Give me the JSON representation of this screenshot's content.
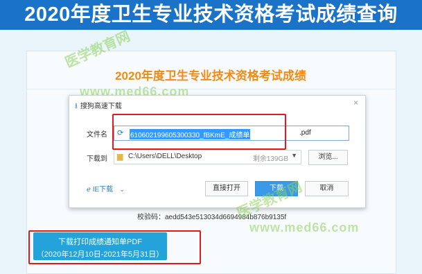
{
  "banner": {
    "title": "2020年度卫生专业技术资格考试成绩查询"
  },
  "page": {
    "title": "2020年度卫生专业技术资格考试成绩",
    "checksum": "校验码：aedd543e513034d6694984b876b9135f",
    "download_button": {
      "line1": "下载打印成绩通知单PDF",
      "line2": "（2020年12月10日-2021年5月31日）"
    }
  },
  "watermark": {
    "cn": "医学教育网",
    "url": "www.med66.com"
  },
  "dialog": {
    "title": "搜狗高速下载",
    "title_icon": "download-icon",
    "close_glyph": "×",
    "file_label": "文件名",
    "file_name_selected": "610602199605300330_fBKmE_成绩单",
    "file_ext": ".pdf",
    "file_icon": "pdf-file-icon",
    "path_label": "下载到",
    "path_value": "C:\\Users\\DELL\\Desktop",
    "free_space": "剩余139GB",
    "browse_label": "浏览...",
    "ie_label": "IE下载",
    "open_label": "直接打开",
    "download_label": "下载",
    "cancel_label": "取消"
  },
  "colors": {
    "banner": "#1a73c8",
    "title": "#f08c14",
    "highlight": "#e11a1a",
    "button": "#23a3d9",
    "selection": "#3399ff"
  }
}
